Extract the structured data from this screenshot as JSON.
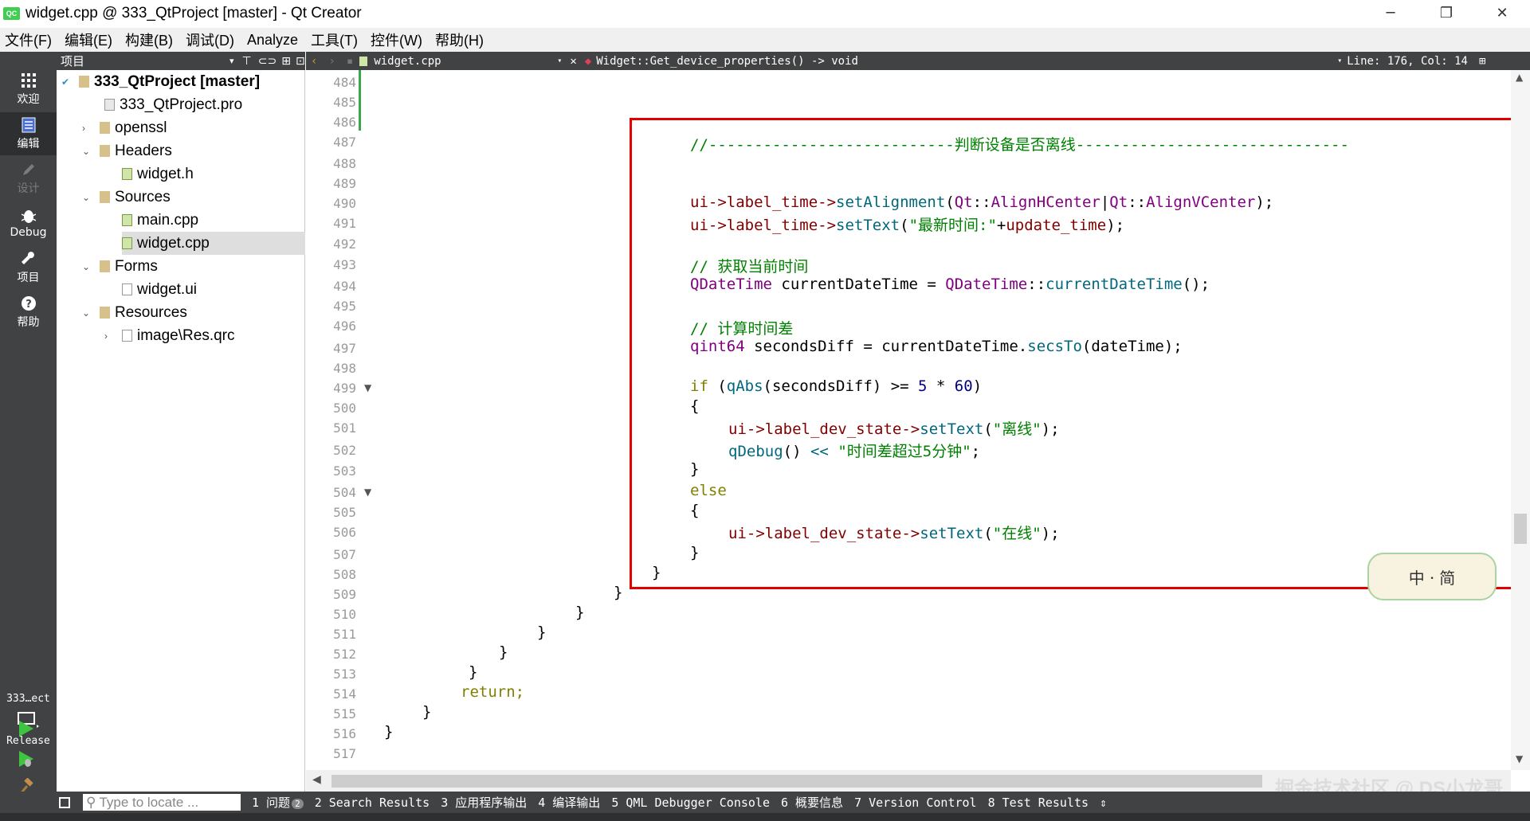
{
  "window": {
    "title": "widget.cpp @ 333_QtProject [master] - Qt Creator",
    "minimize": "─",
    "restore": "❐",
    "close": "✕"
  },
  "menu": [
    "文件(F)",
    "编辑(E)",
    "构建(B)",
    "调试(D)",
    "Analyze",
    "工具(T)",
    "控件(W)",
    "帮助(H)"
  ],
  "modes": [
    {
      "label": "欢迎",
      "icon": "grid-icon"
    },
    {
      "label": "编辑",
      "icon": "document-icon"
    },
    {
      "label": "设计",
      "icon": "pen-icon"
    },
    {
      "label": "Debug",
      "icon": "bug-icon"
    },
    {
      "label": "项目",
      "icon": "wrench-icon"
    },
    {
      "label": "帮助",
      "icon": "help-icon"
    }
  ],
  "kit": {
    "name": "333…ect",
    "config": "Release"
  },
  "project_pane": {
    "title": "项目",
    "tree": [
      {
        "label": "333_QtProject [master]",
        "bold": true
      },
      {
        "label": "333_QtProject.pro"
      },
      {
        "label": "openssl"
      },
      {
        "label": "Headers"
      },
      {
        "label": "widget.h"
      },
      {
        "label": "Sources"
      },
      {
        "label": "main.cpp"
      },
      {
        "label": "widget.cpp"
      },
      {
        "label": "Forms"
      },
      {
        "label": "widget.ui"
      },
      {
        "label": "Resources"
      },
      {
        "label": "image\\Res.qrc"
      }
    ]
  },
  "editor_toolbar": {
    "file": "widget.cpp",
    "symbol": "Widget::Get_device_properties() -> void",
    "position": "Line: 176, Col: 14"
  },
  "line_numbers": [
    "484",
    "485",
    "486",
    "487",
    "488",
    "489",
    "490",
    "491",
    "492",
    "493",
    "494",
    "495",
    "496",
    "497",
    "498",
    "499",
    "500",
    "501",
    "502",
    "503",
    "504",
    "505",
    "506",
    "507",
    "508",
    "509",
    "510",
    "511",
    "512",
    "513",
    "514",
    "515",
    "516",
    "517"
  ],
  "code": {
    "l487": "//---------------------------判断设备是否离线------------------------------",
    "l490_obj": "ui->",
    "l490_mem": "label_time",
    "l490_arrow": "->",
    "l490_fn": "setAlignment",
    "l490_a": "(",
    "l490_qt1": "Qt",
    "l490_sep1": "::",
    "l490_align1": "AlignHCenter",
    "l490_pipe": "|",
    "l490_qt2": "Qt",
    "l490_sep2": "::",
    "l490_align2": "AlignVCenter",
    "l490_end": ");",
    "l491_pre": "ui->",
    "l491_mem": "label_time",
    "l491_arrow": "->",
    "l491_fn": "setText",
    "l491_open": "(",
    "l491_str": "\"最新时间:\"",
    "l491_plus": "+",
    "l491_var": "update_time",
    "l491_end": ");",
    "l493": "// 获取当前时间",
    "l494_type": "QDateTime",
    "l494_var": " currentDateTime = ",
    "l494_type2": "QDateTime",
    "l494_sep": "::",
    "l494_fn": "currentDateTime",
    "l494_end": "();",
    "l496": "// 计算时间差",
    "l497_type": "qint64",
    "l497_var": " secondsDiff = currentDateTime.",
    "l497_fn": "secsTo",
    "l497_end": "(dateTime);",
    "l499_kw": "if",
    "l499_open": " (",
    "l499_fn": "qAbs",
    "l499_rest": "(secondsDiff) >= ",
    "l499_n1": "5",
    "l499_mul": " * ",
    "l499_n2": "60",
    "l499_close": ")",
    "l500": "{",
    "l501_pre": "ui->",
    "l501_mem": "label_dev_state",
    "l501_arrow": "->",
    "l501_fn": "setText",
    "l501_open": "(",
    "l501_str": "\"离线\"",
    "l501_end": ");",
    "l502_fn": "qDebug",
    "l502_mid": "() ",
    "l502_op": "<<",
    "l502_sp": " ",
    "l502_str": "\"时间差超过5分钟\"",
    "l502_end": ";",
    "l503": "}",
    "l504": "else",
    "l505": "{",
    "l506_pre": "ui->",
    "l506_mem": "label_dev_state",
    "l506_arrow": "->",
    "l506_fn": "setText",
    "l506_open": "(",
    "l506_str": "\"在线\"",
    "l506_end": ");",
    "l507": "}",
    "l508": "}",
    "l509": "}",
    "l510": "}",
    "l511": "}",
    "l512": "}",
    "l513": "}",
    "l514": "return;",
    "l515": "}",
    "l516": "}"
  },
  "sticker": "中ㆍ简",
  "statusbar": {
    "locate_placeholder": "Type to locate ...",
    "panes": [
      "1 问题",
      "2 Search Results",
      "3 应用程序输出",
      "4 编译输出",
      "5 QML Debugger Console",
      "6 概要信息",
      "7 Version Control",
      "8 Test Results"
    ],
    "issues_badge": "2"
  },
  "watermark": "掘金技术社区 @ DS小龙哥",
  "colors": {
    "highlight_box": "#e00000",
    "comment": "#008000",
    "type": "#800080",
    "member": "#800000",
    "function": "#00677c",
    "keyword": "#808000"
  }
}
